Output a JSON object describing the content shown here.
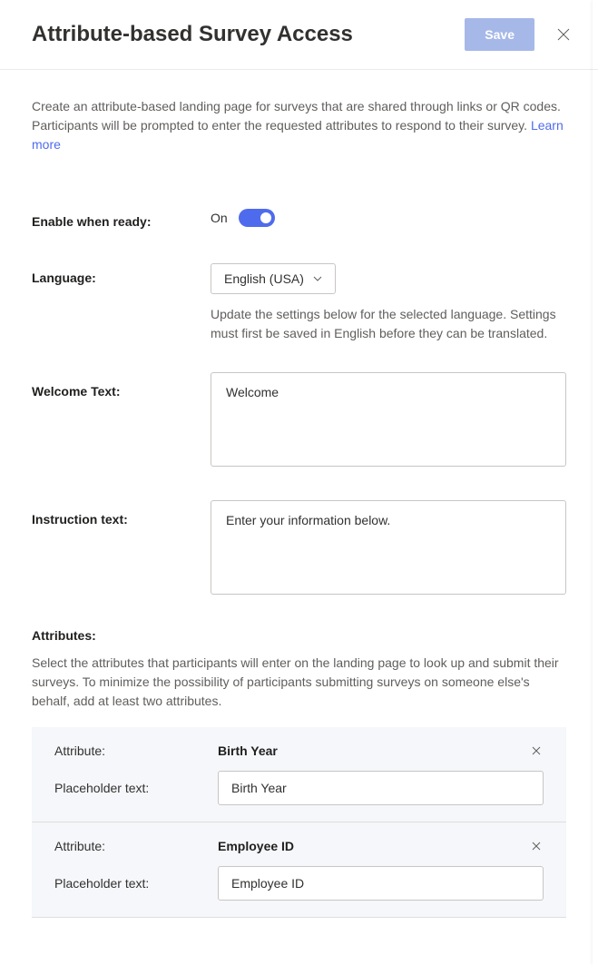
{
  "header": {
    "title": "Attribute-based Survey Access",
    "save_label": "Save"
  },
  "description": {
    "text": "Create an attribute-based landing page for surveys that are shared through links or QR codes. Participants will be prompted to enter the requested attributes to respond to their survey. ",
    "learn_more": "Learn more"
  },
  "enable": {
    "label": "Enable when ready:",
    "state_label": "On"
  },
  "language": {
    "label": "Language:",
    "selected": "English (USA)",
    "hint": "Update the settings below for the selected language. Settings must first be saved in English before they can be translated."
  },
  "welcome": {
    "label": "Welcome Text:",
    "value": "Welcome"
  },
  "instruction": {
    "label": "Instruction text:",
    "value": "Enter your information below."
  },
  "attributes": {
    "label": "Attributes:",
    "description": "Select the attributes that participants will enter on the landing page to look up and submit their surveys. To minimize the possibility of participants submitting surveys on someone else's behalf, add at least two attributes.",
    "row_attr_label": "Attribute:",
    "row_placeholder_label": "Placeholder text:",
    "items": [
      {
        "name": "Birth Year",
        "placeholder": "Birth Year"
      },
      {
        "name": "Employee ID",
        "placeholder": "Employee ID"
      }
    ]
  }
}
